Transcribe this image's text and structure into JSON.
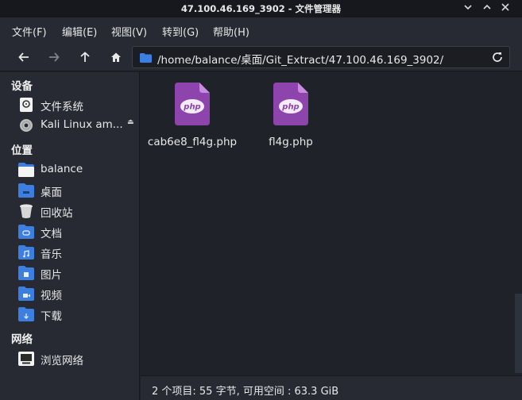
{
  "window": {
    "title": "47.100.46.169_3902 - 文件管理器"
  },
  "menu": [
    "文件(F)",
    "编辑(E)",
    "视图(V)",
    "转到(G)",
    "帮助(H)"
  ],
  "toolbar": {
    "path": "/home/balance/桌面/Git_Extract/47.100.46.169_3902/"
  },
  "sidebar": {
    "devices_header": "设备",
    "devices": [
      {
        "label": "文件系统",
        "icon": "drive-icon"
      },
      {
        "label": "Kali Linux am...",
        "icon": "optical-disc-icon"
      }
    ],
    "places_header": "位置",
    "places": [
      {
        "label": "balance",
        "icon": "home-folder-icon"
      },
      {
        "label": "桌面",
        "icon": "desktop-folder-icon"
      },
      {
        "label": "回收站",
        "icon": "trash-icon"
      },
      {
        "label": "文档",
        "icon": "documents-folder-icon"
      },
      {
        "label": "音乐",
        "icon": "music-folder-icon"
      },
      {
        "label": "图片",
        "icon": "pictures-folder-icon"
      },
      {
        "label": "视频",
        "icon": "videos-folder-icon"
      },
      {
        "label": "下载",
        "icon": "downloads-folder-icon"
      }
    ],
    "network_header": "网络",
    "network": [
      {
        "label": "浏览网络",
        "icon": "network-icon"
      }
    ]
  },
  "files": [
    {
      "name": "cab6e8_fl4g.php",
      "icon": "php-file-icon",
      "badge": "php"
    },
    {
      "name": "fl4g.php",
      "icon": "php-file-icon",
      "badge": "php"
    }
  ],
  "status": {
    "text": "2 个项目: 55 字节, 可用空间 : 63.3 GiB"
  },
  "colors": {
    "folder_blue": "#3d7fe0",
    "php_purple": "#8e44ad"
  }
}
